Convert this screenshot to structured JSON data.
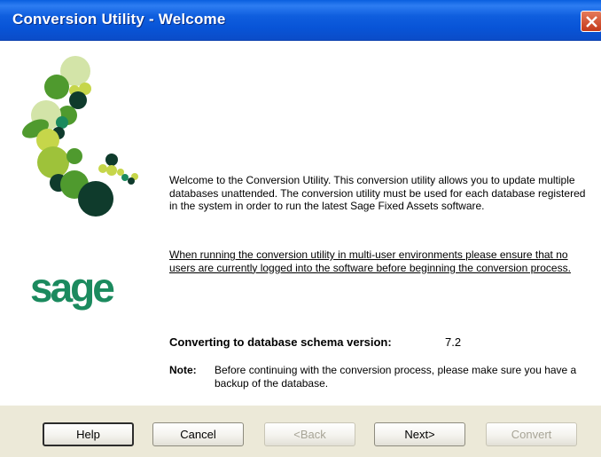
{
  "window": {
    "title": "Conversion Utility - Welcome"
  },
  "logo": {
    "text": "sage"
  },
  "content": {
    "intro": "Welcome to the Conversion Utility. This conversion utility allows you to update multiple databases unattended. The conversion utility must be used for each database registered in the system in order to run the latest Sage Fixed Assets software.",
    "warning": "When running the conversion utility in multi-user environments please ensure that no users are currently logged into the software before beginning the conversion process.",
    "schema_label": "Converting to database schema version:",
    "schema_version": "7.2",
    "note_label": "Note:",
    "note_text": "Before continuing with the conversion process, please make sure you have a backup of the database."
  },
  "buttons": {
    "help": "Help",
    "cancel": "Cancel",
    "back": "<Back",
    "next": "Next>",
    "convert": "Convert"
  },
  "colors": {
    "titlebar": "#0a5fdf",
    "brand_green": "#1b8a5e",
    "leaf_green": "#4f9a2e",
    "lime": "#c6d64a"
  }
}
